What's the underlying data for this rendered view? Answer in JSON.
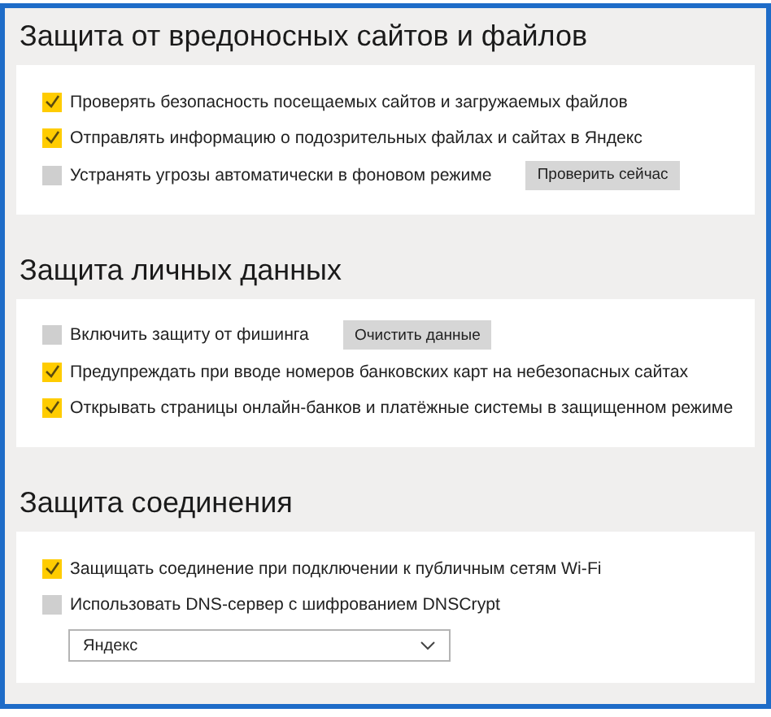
{
  "sections": [
    {
      "title": "Защита от вредоносных сайтов и файлов",
      "items": [
        {
          "kind": "checkbox",
          "label": "Проверять безопасность посещаемых сайтов и загружаемых файлов",
          "checked": true
        },
        {
          "kind": "checkbox",
          "label": "Отправлять информацию о подозрительных файлах и сайтах в Яндекс",
          "checked": true
        },
        {
          "kind": "checkbox",
          "label": "Устранять угрозы автоматически в фоновом режиме",
          "checked": false,
          "button": "Проверить сейчас"
        }
      ]
    },
    {
      "title": "Защита личных данных",
      "items": [
        {
          "kind": "checkbox",
          "label": "Включить защиту от фишинга",
          "checked": false,
          "button": "Очистить данные"
        },
        {
          "kind": "checkbox",
          "label": "Предупреждать при вводе номеров банковских карт на небезопасных сайтах",
          "checked": true
        },
        {
          "kind": "checkbox",
          "label": "Открывать страницы онлайн-банков и платёжные системы в защищенном режиме",
          "checked": true
        }
      ]
    },
    {
      "title": "Защита соединения",
      "items": [
        {
          "kind": "checkbox",
          "label": "Защищать соединение при подключении к публичным сетям Wi-Fi",
          "checked": true
        },
        {
          "kind": "checkbox",
          "label": "Использовать DNS-сервер с шифрованием DNSCrypt",
          "checked": false
        },
        {
          "kind": "select",
          "value": "Яндекс"
        }
      ]
    }
  ]
}
